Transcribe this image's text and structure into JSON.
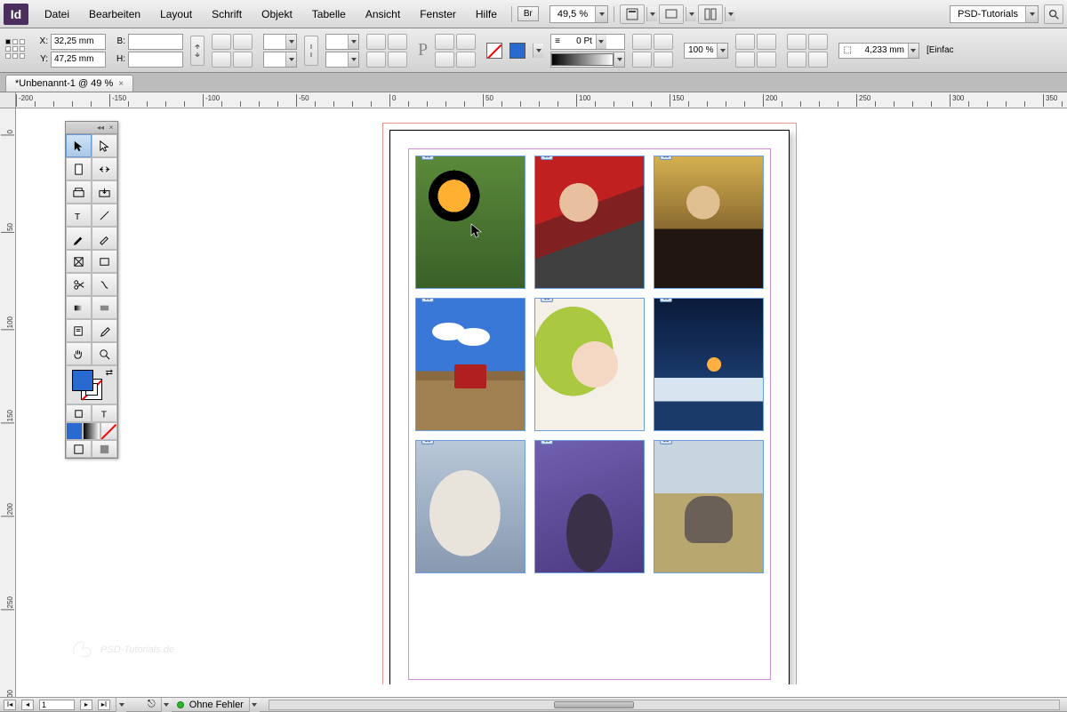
{
  "menubar": {
    "logo": "Id",
    "items": [
      "Datei",
      "Bearbeiten",
      "Layout",
      "Schrift",
      "Objekt",
      "Tabelle",
      "Ansicht",
      "Fenster",
      "Hilfe"
    ],
    "bridge_label": "Br",
    "zoom": "49,5 %",
    "workspace": "PSD-Tutorials"
  },
  "control": {
    "x_label": "X:",
    "x": "32,25 mm",
    "y_label": "Y:",
    "y": "47,25 mm",
    "w_label": "B:",
    "w": "",
    "h_label": "H:",
    "h": "",
    "stroke": "0 Pt",
    "opacity": "100 %",
    "stroke2": "4,233 mm",
    "fit_label": "[Einfac"
  },
  "tab": {
    "title": "*Unbenannt-1 @ 49 %"
  },
  "ruler_h": [
    -200,
    -150,
    -100,
    -50,
    0,
    50,
    100,
    150,
    200,
    250,
    300,
    350
  ],
  "ruler_v": [
    0,
    50,
    100,
    150,
    200,
    250,
    300
  ],
  "tools": [
    "selection",
    "direct-selection",
    "page",
    "gap",
    "content-collector",
    "content-placer",
    "type",
    "line",
    "pen",
    "pencil",
    "rectangle-frame",
    "rectangle",
    "scissors",
    "free-transform",
    "gradient-swatch",
    "gradient-feather",
    "note",
    "eyedropper",
    "hand",
    "zoom"
  ],
  "status": {
    "page": "1",
    "errors": "Ohne Fehler"
  },
  "watermark": "PSD-Tutorials.de",
  "frames": [
    "toucan",
    "woman-car",
    "woman-blonde",
    "tractor",
    "baby",
    "lantern-snow",
    "rabbit",
    "drums",
    "elephant"
  ]
}
